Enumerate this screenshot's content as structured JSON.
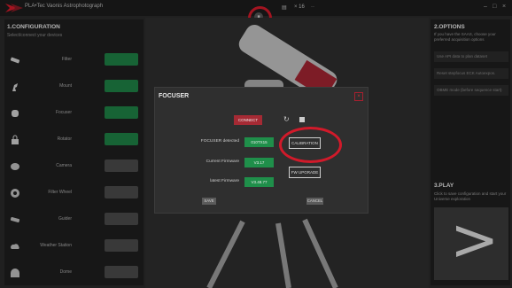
{
  "window": {
    "title": "PLA•Tec Vaonis Astrophotograph",
    "menu": {
      "stop_glyph": "■",
      "folder_label": "▤",
      "count_label": "× 16",
      "extra_label": "··"
    },
    "controls": [
      "–",
      "□",
      "×"
    ]
  },
  "config_panel": {
    "title": "1.CONFIGURATION",
    "subtitle": "Select/connect your devices",
    "devices": [
      {
        "name": "Filter",
        "icon": "tube-icon",
        "status_color": "#1e7f45"
      },
      {
        "name": "Mount",
        "icon": "mount-icon",
        "status_color": "#1e7f45"
      },
      {
        "name": "Focuser",
        "icon": "focuser-icon",
        "status_color": "#1e7f45"
      },
      {
        "name": "Rotator",
        "icon": "lock-icon",
        "status_color": "#1e7f45"
      },
      {
        "name": "Camera",
        "icon": "camera-icon",
        "status_color": "#4a4a4a"
      },
      {
        "name": "Filter Wheel",
        "icon": "wheel-icon",
        "status_color": "#4a4a4a"
      },
      {
        "name": "Guider",
        "icon": "guider-icon",
        "status_color": "#4a4a4a"
      },
      {
        "name": "Weather Station",
        "icon": "weather-icon",
        "status_color": "#4a4a4a"
      },
      {
        "name": "Dome",
        "icon": "dome-icon",
        "status_color": "#4a4a4a"
      }
    ]
  },
  "options_panel": {
    "title": "2.OPTIONS",
    "subtitle": "If you have the SAAS, choose your preferred acquisition options",
    "items": [
      "Use API data to plan dataset",
      "Reset stepfocus ECK Autoexpos.",
      "OBME mode (before sequence start)"
    ]
  },
  "play_panel": {
    "title": "3.PLAY",
    "subtitle": "Click to save configuration and start your Universe exploration",
    "glyph": ">"
  },
  "focuser_dialog": {
    "title": "FOCUSER",
    "close_glyph": "×",
    "connect_label": "CONNECT",
    "refresh_glyph": "↻",
    "focuser_detected_label": "FOCUSER detected",
    "focuser_detected_value": "010TX15",
    "current_firmware_label": "Current Firmware",
    "current_firmware_value": "V3.17",
    "latest_firmware_label": "latest Firmware",
    "latest_firmware_value": "V3.48.77",
    "calibration_label": "CALIBRATION",
    "fw_upgrade_label": "FW UPGRADE",
    "save_label": "SAVE",
    "cancel_label": "CANCEL"
  },
  "colors": {
    "accent_red": "#d11a2a",
    "status_green": "#1f8f4a",
    "button_red": "#a52a34"
  }
}
